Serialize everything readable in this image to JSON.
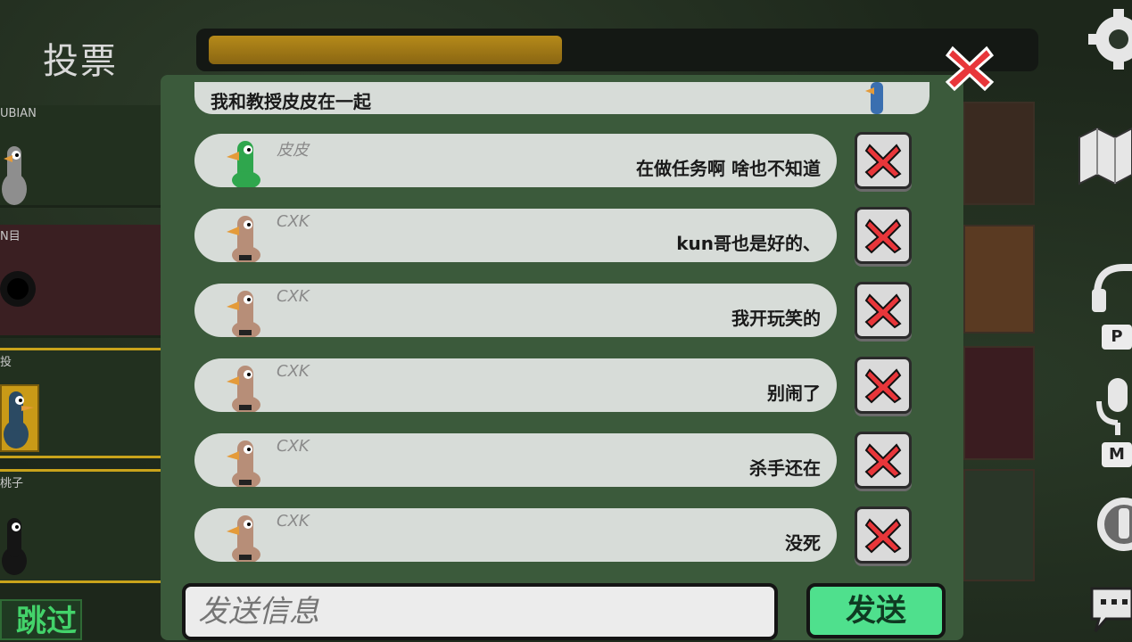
{
  "vote_panel": {
    "title": "投票",
    "players": [
      {
        "name": "UBIAN",
        "state": "alive"
      },
      {
        "name": "N目",
        "state": "dead"
      },
      {
        "name": "投",
        "state": "voted"
      },
      {
        "name": "桃子",
        "state": "alive"
      }
    ],
    "skip_label": "跳过"
  },
  "timer": {
    "progress": 0.42,
    "color": "#a87f18"
  },
  "chat": {
    "pinned_message": "我和教授皮皮在一起",
    "messages": [
      {
        "sender": "皮皮",
        "text": "在做任务啊 啥也不知道",
        "avatar": "green-goose"
      },
      {
        "sender": "CXK",
        "text": "kun哥也是好的、",
        "avatar": "tan-goose"
      },
      {
        "sender": "CXK",
        "text": "我开玩笑的",
        "avatar": "tan-goose"
      },
      {
        "sender": "CXK",
        "text": "别闹了",
        "avatar": "tan-goose"
      },
      {
        "sender": "CXK",
        "text": "杀手还在",
        "avatar": "tan-goose"
      },
      {
        "sender": "CXK",
        "text": "没死",
        "avatar": "tan-goose"
      }
    ],
    "input_placeholder": "发送信息",
    "send_label": "发送"
  },
  "right_bar": {
    "icons": [
      "gear-icon",
      "map-icon",
      "headset-icon",
      "microphone-icon",
      "role-icon",
      "chat-icon"
    ],
    "keys": [
      "P",
      "M"
    ]
  },
  "colors": {
    "accent_green": "#4fe08d",
    "delete_red": "#e8363a",
    "panel_green": "#3b5a3b"
  }
}
